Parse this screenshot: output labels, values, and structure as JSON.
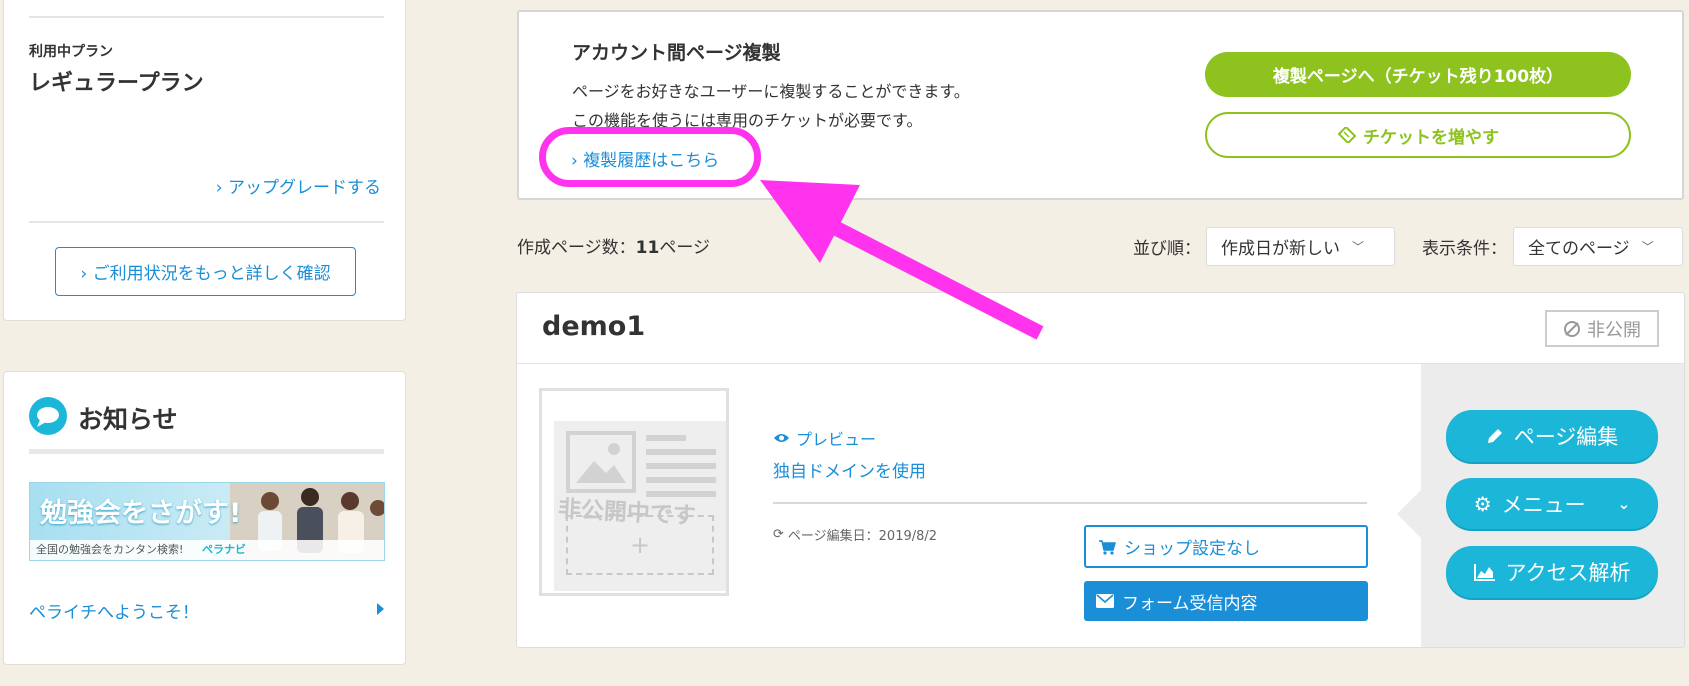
{
  "plan": {
    "label": "利用中プラン",
    "name": "レギュラープラン",
    "upgrade": "› アップグレードする",
    "usage_details": "› ご利用状況をもっと詳しく確認"
  },
  "news": {
    "title": "お知らせ",
    "banner_title": "勉強会をさがす!",
    "banner_sub": "全国の勉強会をカンタン検索!",
    "banner_logo": "ペラナビ",
    "welcome": "ペライチへようこそ！"
  },
  "copy": {
    "title": "アカウント間ページ複製",
    "desc1": "ページをお好きなユーザーに複製することができます。",
    "desc2": "この機能を使うには専用のチケットが必要です。",
    "history_link": "› 複製履歴はこちら",
    "copy_button": "複製ページへ（チケット残り100枚）",
    "ticket_button": "チケットを増やす"
  },
  "toolbar": {
    "count_label": "作成ページ数：",
    "count_value": "11",
    "count_unit": "ページ",
    "sort_label": "並び順：",
    "sort_value": "作成日が新しい",
    "filter_label": "表示条件：",
    "filter_value": "全てのページ"
  },
  "page": {
    "name": "demo1",
    "status": "非公開",
    "thumb_text": "非公開中です",
    "preview": "プレビュー",
    "domain": "独自ドメインを使用",
    "edited": "ページ編集日：2019/8/2",
    "shop": "ショップ設定なし",
    "form": "フォーム受信内容",
    "edit_button": "ページ編集",
    "menu_button": "メニュー",
    "analytics_button": "アクセス解析"
  },
  "colors": {
    "accent": "#1cb6d9",
    "green": "#8dc21f",
    "link": "#1a8fd8",
    "annotation": "#ff33ee"
  }
}
